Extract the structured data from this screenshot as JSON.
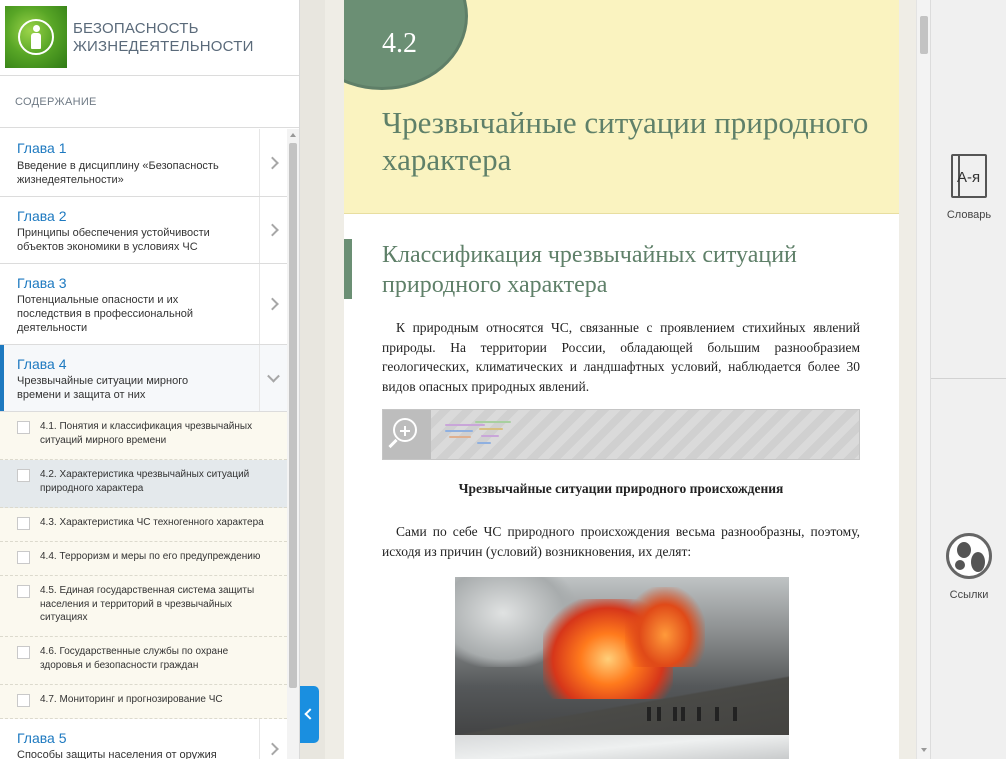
{
  "brand": {
    "title": "БЕЗОПАСНОСТЬ ЖИЗНЕДЕЯТЕЛЬНОСТИ",
    "logo_icon": "person-in-circle-icon"
  },
  "toc": {
    "header": "СОДЕРЖАНИЕ",
    "chapters_before": [
      {
        "title": "Глава 1",
        "subtitle": "Введение в дисциплину «Безопасность жизнедеятельности»"
      },
      {
        "title": "Глава 2",
        "subtitle": "Принципы обеспечения устойчивости объектов экономики в условиях ЧС"
      },
      {
        "title": "Глава 3",
        "subtitle": "Потенциальные опасности и их последствия в профессиональной деятельности"
      }
    ],
    "active_chapter": {
      "title": "Глава 4",
      "subtitle": "Чрезвычайные ситуации мирного времени и защита от них"
    },
    "subsections": [
      {
        "label": "4.1. Понятия и классификация чрезвычайных ситуаций мирного времени"
      },
      {
        "label": "4.2. Характеристика чрезвычайных ситуаций природного характера",
        "selected": true
      },
      {
        "label": "4.3. Характеристика ЧС техногенного характера"
      },
      {
        "label": "4.4. Терроризм и меры по его предупреждению"
      },
      {
        "label": "4.5. Единая государственная система защиты населения и территорий в чрезвычайных ситуациях"
      },
      {
        "label": "4.6. Государственные службы по охране здоровья и безопасности граждан"
      },
      {
        "label": "4.7. Мониторинг и прогнозирование ЧС"
      }
    ],
    "chapters_after": [
      {
        "title": "Глава 5",
        "subtitle": "Способы защиты населения от оружия"
      }
    ]
  },
  "content": {
    "section_number": "4.2",
    "section_title": "Чрезвычайные ситуации природного характера",
    "subsection_title": "Классификация чрезвычайных ситуаций природного характера",
    "paragraph1": "К природным относятся ЧС, связанные с проявлением стихийных явлений природы. На территории России, обладающей большим разнообразием геологических, климатических и ландшафтных условий, наблюдается более 30 видов опасных природных явлений.",
    "figure_caption": "Чрезвычайные ситуации природного происхождения",
    "paragraph2": "Сами по себе ЧС природного происхождения весьма разнообразны, поэтому, исходя из причин (условий) возникновения, их делят:",
    "zoom_icon": "zoom-in-icon",
    "photo_icon": "volcano-eruption-photo"
  },
  "right_panel": {
    "dictionary_label": "Словарь",
    "dictionary_icon_text": "А-я",
    "links_label": "Ссылки",
    "links_icon": "globe-icon"
  },
  "colors": {
    "accent_blue": "#1d79c0",
    "section_green": "#6b8f74",
    "section_bg": "#faf3c0"
  }
}
